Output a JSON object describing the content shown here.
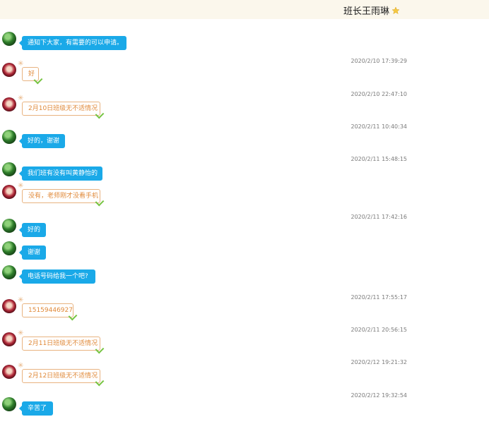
{
  "header": {
    "title": "班长王雨琳",
    "star_icon": "star-icon"
  },
  "colors": {
    "header_bg": "#fbf7ec",
    "teacher_bubble": "#1aa9e8",
    "student_text": "#e08a3a",
    "student_border": "#e8b380",
    "check": "#76c442"
  },
  "messages": [
    {
      "sender": "teacher",
      "text": "通知下大家，有需要的可以申请。"
    },
    {
      "timestamp": "2020/2/10 17:39:29"
    },
    {
      "sender": "student",
      "text": "好"
    },
    {
      "timestamp": "2020/2/10 22:47:10"
    },
    {
      "sender": "student",
      "text": "2月10日班级无不适情况"
    },
    {
      "timestamp": "2020/2/11 10:40:34"
    },
    {
      "sender": "teacher",
      "text": "好的，谢谢"
    },
    {
      "timestamp": "2020/2/11 15:48:15"
    },
    {
      "sender": "teacher",
      "text": "我们班有没有叫黄静怡的"
    },
    {
      "sender": "student",
      "text": "没有，老师刚才没看手机"
    },
    {
      "timestamp": "2020/2/11 17:42:16"
    },
    {
      "sender": "teacher",
      "text": "好的"
    },
    {
      "sender": "teacher",
      "text": "谢谢"
    },
    {
      "sender": "teacher",
      "text": "电话号码给我一个吧?"
    },
    {
      "timestamp": "2020/2/11 17:55:17"
    },
    {
      "sender": "student",
      "text": "15159446927"
    },
    {
      "timestamp": "2020/2/11 20:56:15"
    },
    {
      "sender": "student",
      "text": "2月11日班级无不适情况"
    },
    {
      "timestamp": "2020/2/12 19:21:32"
    },
    {
      "sender": "student",
      "text": "2月12日班级无不适情况"
    },
    {
      "timestamp": "2020/2/12 19:32:54"
    },
    {
      "sender": "teacher",
      "text": "辛苦了"
    }
  ]
}
